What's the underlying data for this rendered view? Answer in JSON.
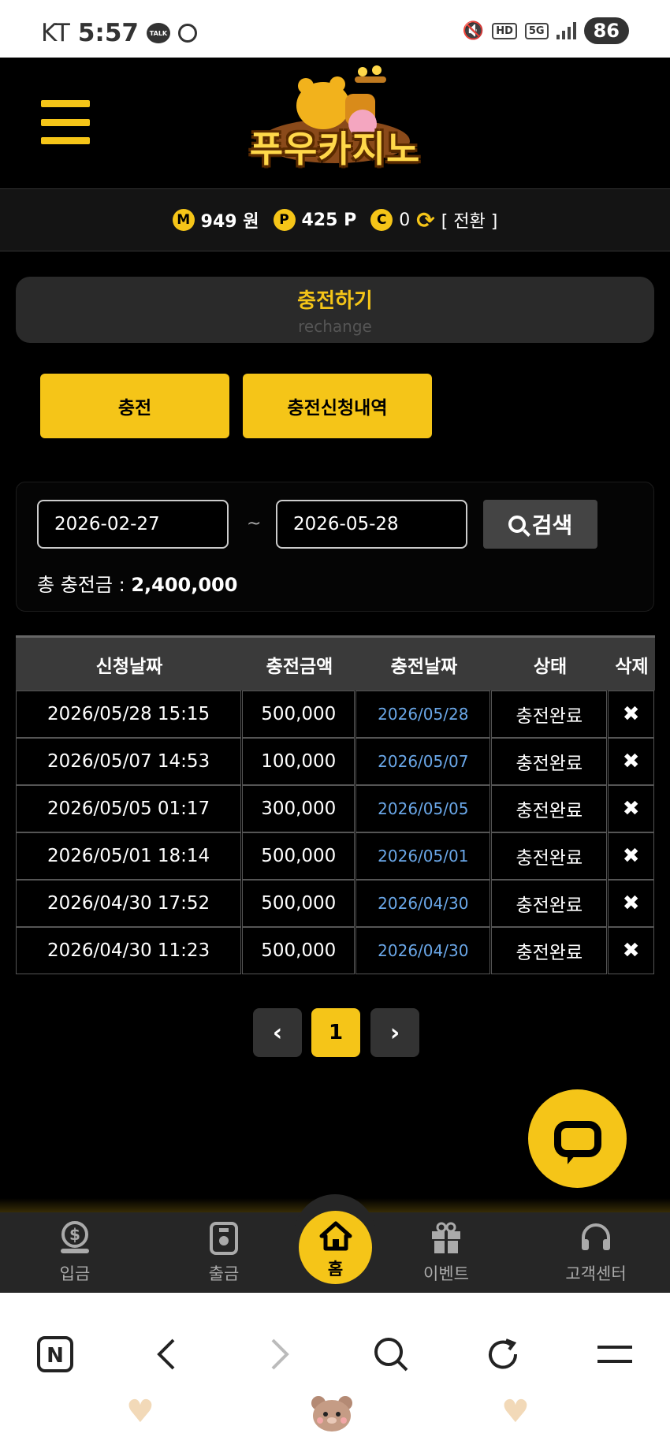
{
  "status_bar": {
    "carrier": "KT",
    "time": "5:57",
    "talk_badge": "TALK",
    "hd": "HD",
    "net": "5G",
    "battery": "86"
  },
  "header": {
    "logo_text": "푸우카지노",
    "icons": {
      "menu": "hamburger-menu-icon"
    }
  },
  "balance": {
    "money_badge": "M",
    "money": "949 원",
    "point_badge": "P",
    "point": "425 P",
    "coin_badge": "C",
    "coin": "0",
    "switch_label": "[ 전환 ]",
    "accent": "#f5c518"
  },
  "title": {
    "main": "충전하기",
    "sub": "rechange"
  },
  "tabs": [
    {
      "label": "충전"
    },
    {
      "label": "충전신청내역"
    }
  ],
  "search": {
    "from_date": "2026-02-27",
    "separator": "~",
    "to_date": "2026-05-28",
    "button_label": "검색",
    "total_label": "총 충전금 :",
    "total_value": "2,400,000"
  },
  "table": {
    "headers": [
      "신청날짜",
      "충전금액",
      "충전날짜",
      "상태",
      "삭제"
    ],
    "rows": [
      {
        "requested": "2026/05/28 15:15",
        "amount": "500,000",
        "charged": "2026/05/28",
        "status": "충전완료",
        "delete": "✖"
      },
      {
        "requested": "2026/05/07 14:53",
        "amount": "100,000",
        "charged": "2026/05/07",
        "status": "충전완료",
        "delete": "✖"
      },
      {
        "requested": "2026/05/05 01:17",
        "amount": "300,000",
        "charged": "2026/05/05",
        "status": "충전완료",
        "delete": "✖"
      },
      {
        "requested": "2026/05/01 18:14",
        "amount": "500,000",
        "charged": "2026/05/01",
        "status": "충전완료",
        "delete": "✖"
      },
      {
        "requested": "2026/04/30 17:52",
        "amount": "500,000",
        "charged": "2026/04/30",
        "status": "충전완료",
        "delete": "✖"
      },
      {
        "requested": "2026/04/30 11:23",
        "amount": "500,000",
        "charged": "2026/04/30",
        "status": "충전완료",
        "delete": "✖"
      }
    ]
  },
  "pagination": {
    "prev": "‹",
    "current": "1",
    "next": "›"
  },
  "bottom_nav": [
    {
      "label": "입금",
      "icon": "deposit-icon"
    },
    {
      "label": "출금",
      "icon": "withdraw-icon"
    },
    {
      "label": "홈",
      "icon": "home-icon"
    },
    {
      "label": "이벤트",
      "icon": "gift-icon"
    },
    {
      "label": "고객센터",
      "icon": "headset-icon"
    }
  ],
  "browser_bar": {
    "naver": "N"
  }
}
